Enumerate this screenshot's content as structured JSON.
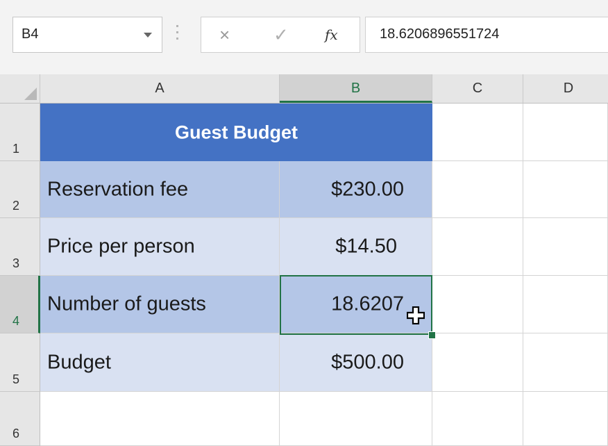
{
  "name_box": {
    "value": "B4"
  },
  "formula_bar": {
    "cancel_icon": "×",
    "enter_icon": "✓",
    "fx_label": "fx",
    "value": "18.6206896551724"
  },
  "columns": [
    "A",
    "B",
    "C",
    "D"
  ],
  "rows": [
    "1",
    "2",
    "3",
    "4",
    "5",
    "6"
  ],
  "selected_cell": "B4",
  "table": {
    "title": "Guest Budget",
    "rows": [
      {
        "label": "Reservation fee",
        "value": "$230.00"
      },
      {
        "label": "Price per person",
        "value": "$14.50"
      },
      {
        "label": "Number of guests",
        "value": "18.6207"
      },
      {
        "label": "Budget",
        "value": "$500.00"
      }
    ]
  },
  "colors": {
    "header_blue": "#4472c4",
    "row_dark": "#b4c6e7",
    "row_light": "#d9e1f2",
    "selection_green": "#217346"
  },
  "icons": [
    "dropdown-arrow-icon",
    "cancel-icon",
    "enter-icon",
    "fx-icon",
    "select-all-icon",
    "fill-cursor-icon"
  ]
}
